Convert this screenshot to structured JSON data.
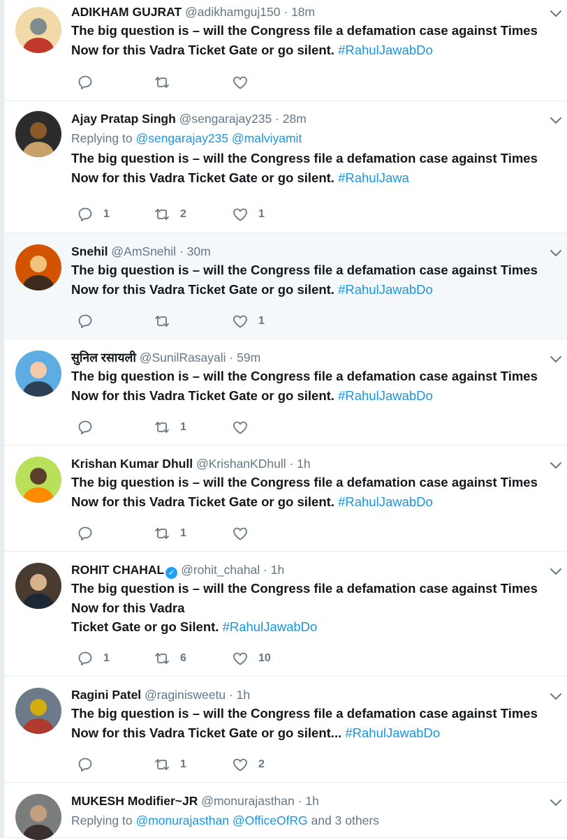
{
  "tweets": [
    {
      "name": "ADIKHAM GUJRAT",
      "handle": "@adikhamguj150",
      "time": "· 18m",
      "verified": false,
      "reply_prefix": "",
      "reply_to": [],
      "reply_suffix": "",
      "text_lines": [
        "The big question is – will the Congress file a defamation case against Times",
        "Now for this Vadra Ticket Gate or go silent."
      ],
      "hashtag": "#RahulJawabDo",
      "counts": {
        "reply": "",
        "retweet": "",
        "like": ""
      }
    },
    {
      "name": "Ajay Pratap Singh",
      "handle": "@sengarajay235",
      "time": "· 28m",
      "verified": false,
      "reply_prefix": "Replying to",
      "reply_to": [
        "@sengarajay235",
        "@malviyamit"
      ],
      "reply_suffix": "",
      "text_lines": [
        "The big question is – will the Congress file a defamation case against Times",
        "Now for this Vadra Ticket Gate or go silent."
      ],
      "hashtag": "#RahulJawa",
      "counts": {
        "reply": "1",
        "retweet": "2",
        "like": "1"
      }
    },
    {
      "name": "Snehil",
      "handle": "@AmSnehil",
      "time": "· 30m",
      "verified": false,
      "reply_prefix": "",
      "reply_to": [],
      "reply_suffix": "",
      "text_lines": [
        "The big question is – will the Congress file a defamation case against Times",
        "Now for this Vadra Ticket Gate or go silent."
      ],
      "hashtag": "#RahulJawabDo",
      "counts": {
        "reply": "",
        "retweet": "",
        "like": "1"
      }
    },
    {
      "name": "सुनिल रसायली",
      "handle": "@SunilRasayali",
      "time": "· 59m",
      "verified": false,
      "reply_prefix": "",
      "reply_to": [],
      "reply_suffix": "",
      "text_lines": [
        "The big question is – will the Congress file a defamation case against Times",
        "Now for this Vadra Ticket Gate or go silent."
      ],
      "hashtag": "#RahulJawabDo",
      "counts": {
        "reply": "",
        "retweet": "1",
        "like": ""
      }
    },
    {
      "name": "Krishan Kumar Dhull",
      "handle": "@KrishanKDhull",
      "time": "· 1h",
      "verified": false,
      "reply_prefix": "",
      "reply_to": [],
      "reply_suffix": "",
      "text_lines": [
        "The big question is – will the Congress file a defamation case against Times",
        "Now for this Vadra Ticket Gate or go silent."
      ],
      "hashtag": "#RahulJawabDo",
      "counts": {
        "reply": "",
        "retweet": "1",
        "like": ""
      }
    },
    {
      "name": "ROHIT CHAHAL",
      "handle": "@rohit_chahal",
      "time": "· 1h",
      "verified": true,
      "reply_prefix": "",
      "reply_to": [],
      "reply_suffix": "",
      "text_lines": [
        "The big question is – will the Congress file a defamation case against Times",
        "Now for this Vadra",
        "Ticket Gate or go Silent."
      ],
      "hashtag": "#RahulJawabDo",
      "counts": {
        "reply": "1",
        "retweet": "6",
        "like": "10"
      }
    },
    {
      "name": "Ragini Patel",
      "handle": "@raginisweetu",
      "time": "· 1h",
      "verified": false,
      "reply_prefix": "",
      "reply_to": [],
      "reply_suffix": "",
      "text_lines": [
        "The big question is – will the Congress file a defamation case against Times",
        "Now for this Vadra Ticket Gate or go silent..."
      ],
      "hashtag": "#RahulJawabDo",
      "counts": {
        "reply": "",
        "retweet": "1",
        "like": "2"
      }
    },
    {
      "name": "MUKESH Modifier~JR",
      "handle": "@monurajasthan",
      "time": "· 1h",
      "verified": false,
      "reply_prefix": "Replying to",
      "reply_to": [
        "@monurajasthan",
        "@OfficeOfRG"
      ],
      "reply_suffix": "and 3 others",
      "text_lines": [],
      "hashtag": "",
      "counts": {
        "reply": "",
        "retweet": "",
        "like": ""
      }
    }
  ],
  "colors": {
    "link": "#1b95e0",
    "muted": "#657786",
    "text": "#14171a",
    "divider": "#e6ecf0",
    "highlight_bg": "#f5f8fa",
    "verified": "#1da1f2"
  },
  "icons": {
    "reply": "reply-icon",
    "retweet": "retweet-icon",
    "like": "heart-icon",
    "menu": "chevron-down-icon",
    "verified": "verified-badge-icon"
  }
}
